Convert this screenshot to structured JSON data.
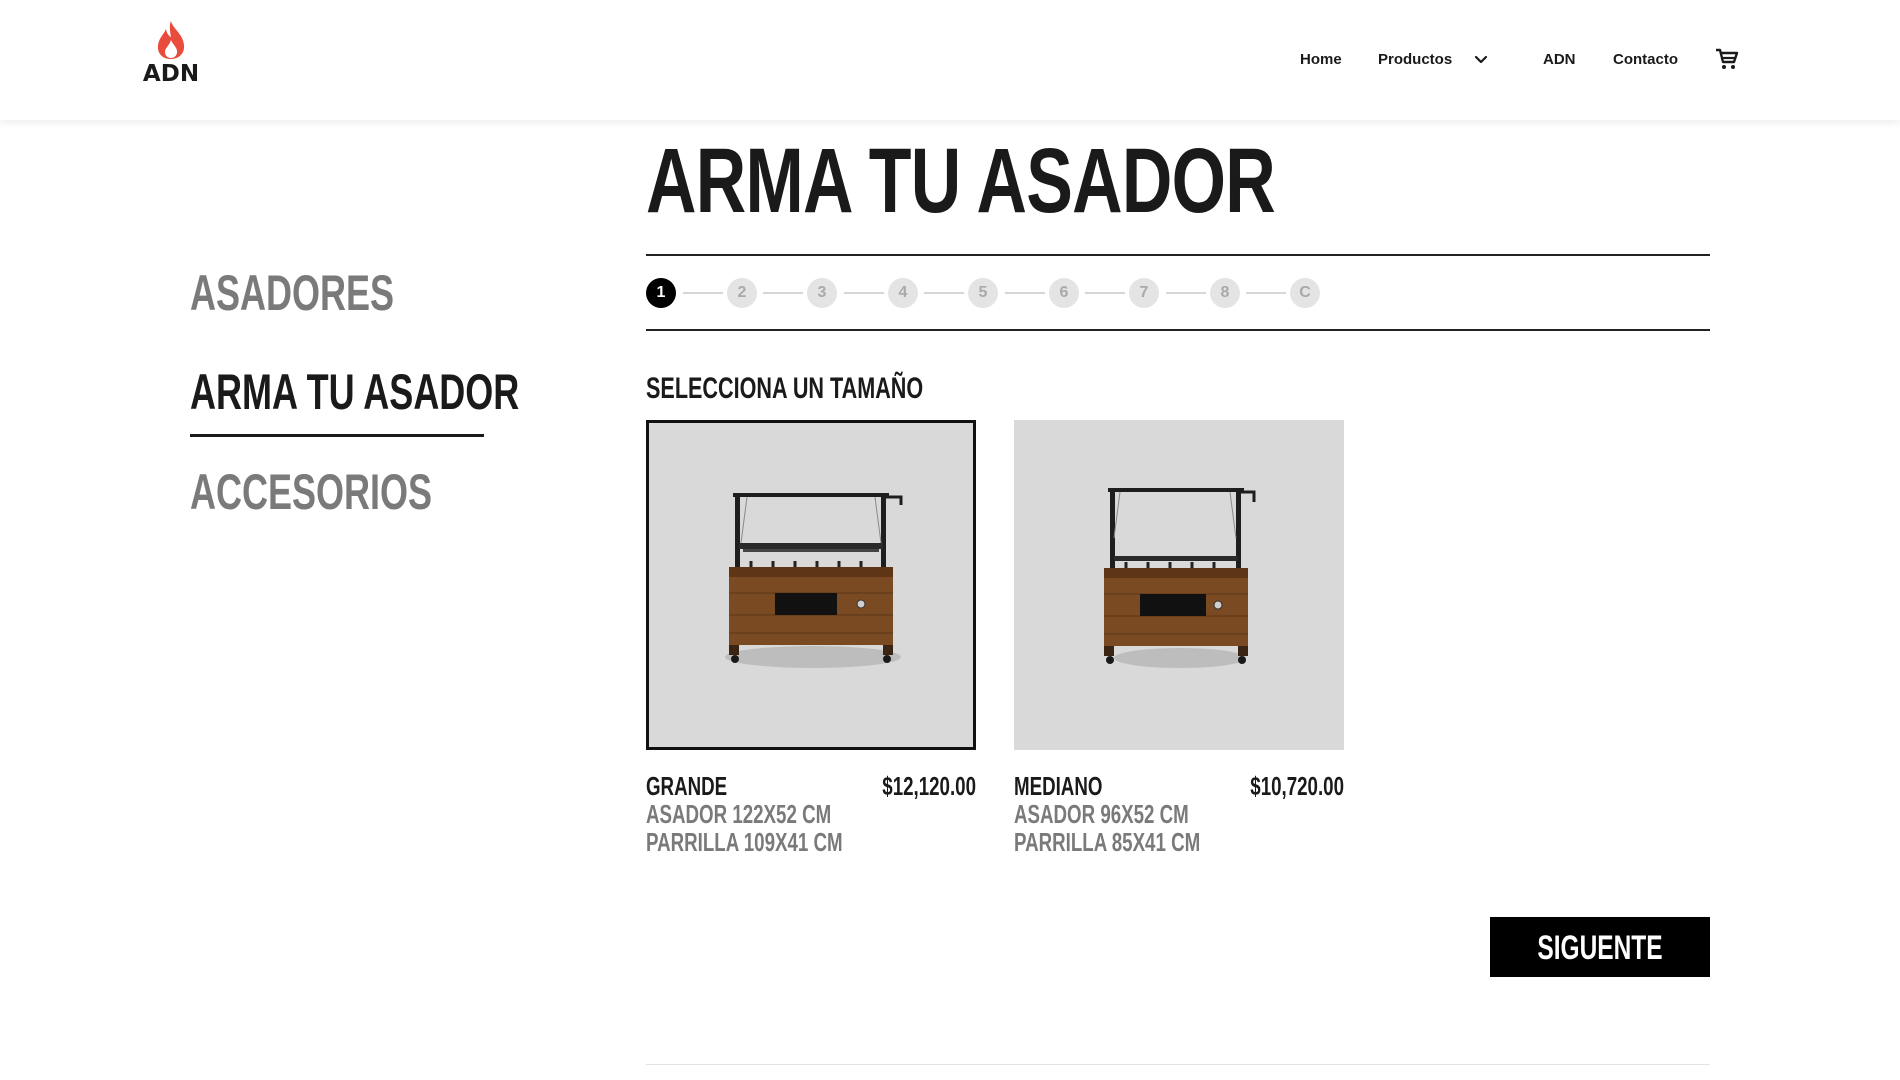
{
  "brand": {
    "logo_text": "ADN",
    "logo_icon": "flame-icon",
    "flame_color": "#e94b3c"
  },
  "nav": {
    "items": [
      "Home",
      "Productos",
      "ADN",
      "Contacto"
    ],
    "productos_dropdown_icon": "chevron-down-icon",
    "cart_icon": "shopping-cart-icon"
  },
  "page": {
    "title": "ARMA TU ASADOR"
  },
  "sidebar": {
    "items": [
      {
        "label": "ASADORES",
        "active": false
      },
      {
        "label": "ARMA TU ASADOR",
        "active": true
      },
      {
        "label": "ACCESORIOS",
        "active": false
      }
    ]
  },
  "steps": {
    "items": [
      "1",
      "2",
      "3",
      "4",
      "5",
      "6",
      "7",
      "8",
      "C"
    ],
    "active_index": 0
  },
  "section": {
    "label": "SELECCIONA UN TAMAÑO"
  },
  "products": [
    {
      "name": "GRANDE",
      "price": "$12,120.00",
      "spec1": "ASADOR 122X52 CM",
      "spec2": "PARRILLA 109X41 CM",
      "selected": true
    },
    {
      "name": "MEDIANO",
      "price": "$10,720.00",
      "spec1": "ASADOR 96X52 CM",
      "spec2": "PARRILLA 85X41 CM",
      "selected": false
    }
  ],
  "actions": {
    "next_label": "SIGUENTE"
  },
  "colors": {
    "accent": "#000000",
    "muted_text": "#7a7a7a",
    "card_bg": "#d9d9d9",
    "wood": "#7a4a22"
  }
}
